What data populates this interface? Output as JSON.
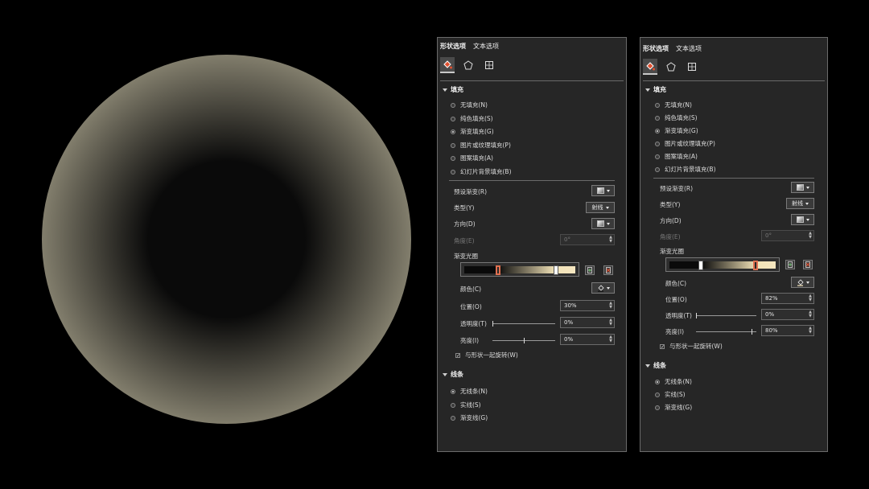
{
  "colors": {
    "panel_bg": "#262626",
    "accent_red": "#e05030",
    "gradient_dark": "#0a0a0a",
    "gradient_light": "#d8d1b3"
  },
  "panel_a": {
    "tabs": [
      "形状选项",
      "文本选项"
    ],
    "icons": [
      "fill-line-icon",
      "effects-pentagon-icon",
      "size-properties-icon"
    ],
    "fill_header": "填充",
    "fill_options": [
      {
        "label": "无填充(N)",
        "selected": false
      },
      {
        "label": "纯色填充(S)",
        "selected": false
      },
      {
        "label": "渐变填充(G)",
        "selected": true
      },
      {
        "label": "图片或纹理填充(P)",
        "selected": false
      },
      {
        "label": "图案填充(A)",
        "selected": false
      },
      {
        "label": "幻灯片背景填充(B)",
        "selected": false
      }
    ],
    "preset_label": "预设渐变(R)",
    "type_label": "类型(Y)",
    "type_value": "射线",
    "direction_label": "方向(D)",
    "angle_label": "角度(E)",
    "angle_value": "0°",
    "stops_label": "渐变光圈",
    "color_label": "颜色(C)",
    "position_label": "位置(O)",
    "position_value": "30%",
    "transparency_label": "透明度(T)",
    "transparency_value": "0%",
    "brightness_label": "亮度(I)",
    "brightness_value": "0%",
    "rotate_label": "与形状一起旋转(W)",
    "rotate_checked": true,
    "line_header": "线条",
    "line_options": [
      {
        "label": "无线条(N)",
        "selected": true
      },
      {
        "label": "实线(S)",
        "selected": false
      },
      {
        "label": "渐变线(G)",
        "selected": false
      }
    ]
  },
  "panel_b": {
    "tabs": [
      "形状选项",
      "文本选项"
    ],
    "icons": [
      "fill-line-icon",
      "effects-pentagon-icon",
      "size-properties-icon"
    ],
    "fill_header": "填充",
    "fill_options": [
      {
        "label": "无填充(N)",
        "selected": false
      },
      {
        "label": "纯色填充(S)",
        "selected": false
      },
      {
        "label": "渐变填充(G)",
        "selected": true
      },
      {
        "label": "图片或纹理填充(P)",
        "selected": false
      },
      {
        "label": "图案填充(A)",
        "selected": false
      },
      {
        "label": "幻灯片背景填充(B)",
        "selected": false
      }
    ],
    "preset_label": "预设渐变(R)",
    "type_label": "类型(Y)",
    "type_value": "射线",
    "direction_label": "方向(D)",
    "angle_label": "角度(E)",
    "angle_value": "0°",
    "stops_label": "渐变光圈",
    "color_label": "颜色(C)",
    "position_label": "位置(O)",
    "position_value": "82%",
    "transparency_label": "透明度(T)",
    "transparency_value": "0%",
    "brightness_label": "亮度(I)",
    "brightness_value": "80%",
    "rotate_label": "与形状一起旋转(W)",
    "rotate_checked": true,
    "line_header": "线条",
    "line_options": [
      {
        "label": "无线条(N)",
        "selected": true
      },
      {
        "label": "实线(S)",
        "selected": false
      },
      {
        "label": "渐变线(G)",
        "selected": false
      }
    ]
  }
}
